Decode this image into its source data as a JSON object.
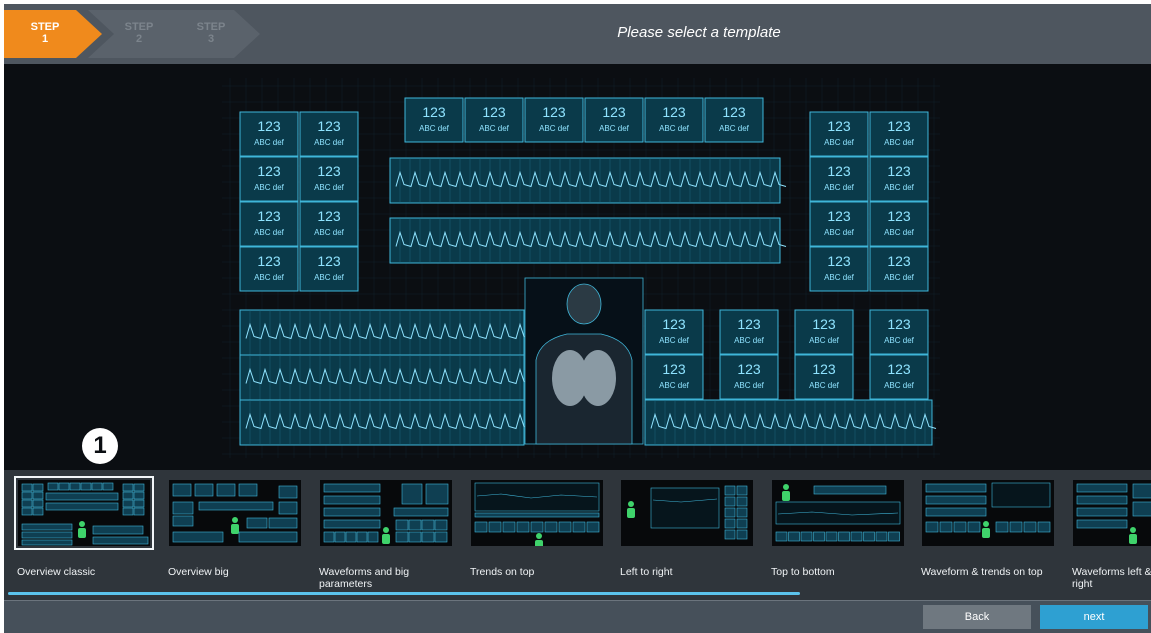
{
  "header": {
    "steps": [
      {
        "label": "STEP",
        "num": "1"
      },
      {
        "label": "STEP",
        "num": "2"
      },
      {
        "label": "STEP",
        "num": "3"
      }
    ],
    "title": "Please select a template"
  },
  "preview": {
    "value_text": "123",
    "label_text": "ABC def"
  },
  "marker": "1",
  "templates": [
    {
      "label": "Overview classic",
      "selected": true
    },
    {
      "label": "Overview big",
      "selected": false
    },
    {
      "label": "Waveforms and big parameters",
      "selected": false
    },
    {
      "label": "Trends on top",
      "selected": false
    },
    {
      "label": "Left to right",
      "selected": false
    },
    {
      "label": "Top to bottom",
      "selected": false
    },
    {
      "label": "Waveform & trends on top",
      "selected": false
    },
    {
      "label": "Waveforms left & parameters right",
      "selected": false
    }
  ],
  "footer": {
    "back": "Back",
    "next": "next"
  },
  "colors": {
    "accent": "#f08a1c",
    "cyan": "#3fb6d9",
    "next": "#2ea0d2"
  }
}
